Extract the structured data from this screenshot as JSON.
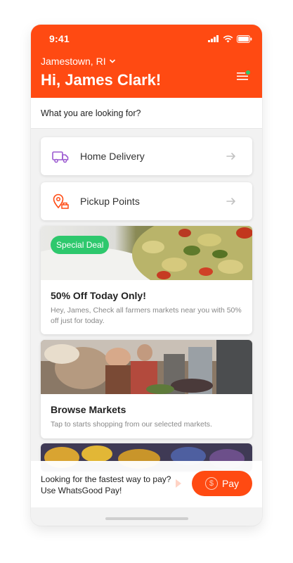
{
  "status": {
    "time": "9:41"
  },
  "header": {
    "location": "Jamestown, RI",
    "greeting": "Hi, James Clark!"
  },
  "search": {
    "label": "What you are looking for?"
  },
  "options": [
    {
      "label": "Home Delivery",
      "icon": "delivery-truck-icon"
    },
    {
      "label": "Pickup Points",
      "icon": "pickup-pin-icon"
    }
  ],
  "cards": [
    {
      "badge": "Special Deal",
      "title": "50% Off Today Only!",
      "subtitle": "Hey, James, Check all farmers markets near you with 50% off just for today."
    },
    {
      "title": "Browse Markets",
      "subtitle": "Tap to starts shopping from our selected markets."
    }
  ],
  "pay_banner": {
    "text": "Looking for the fastest way to pay? Use WhatsGood Pay!",
    "button_label": "Pay",
    "coin_symbol": "$"
  },
  "colors": {
    "brand": "#ff4a12",
    "accent_green": "#2ec86d",
    "icon_purple": "#9b59d0"
  }
}
